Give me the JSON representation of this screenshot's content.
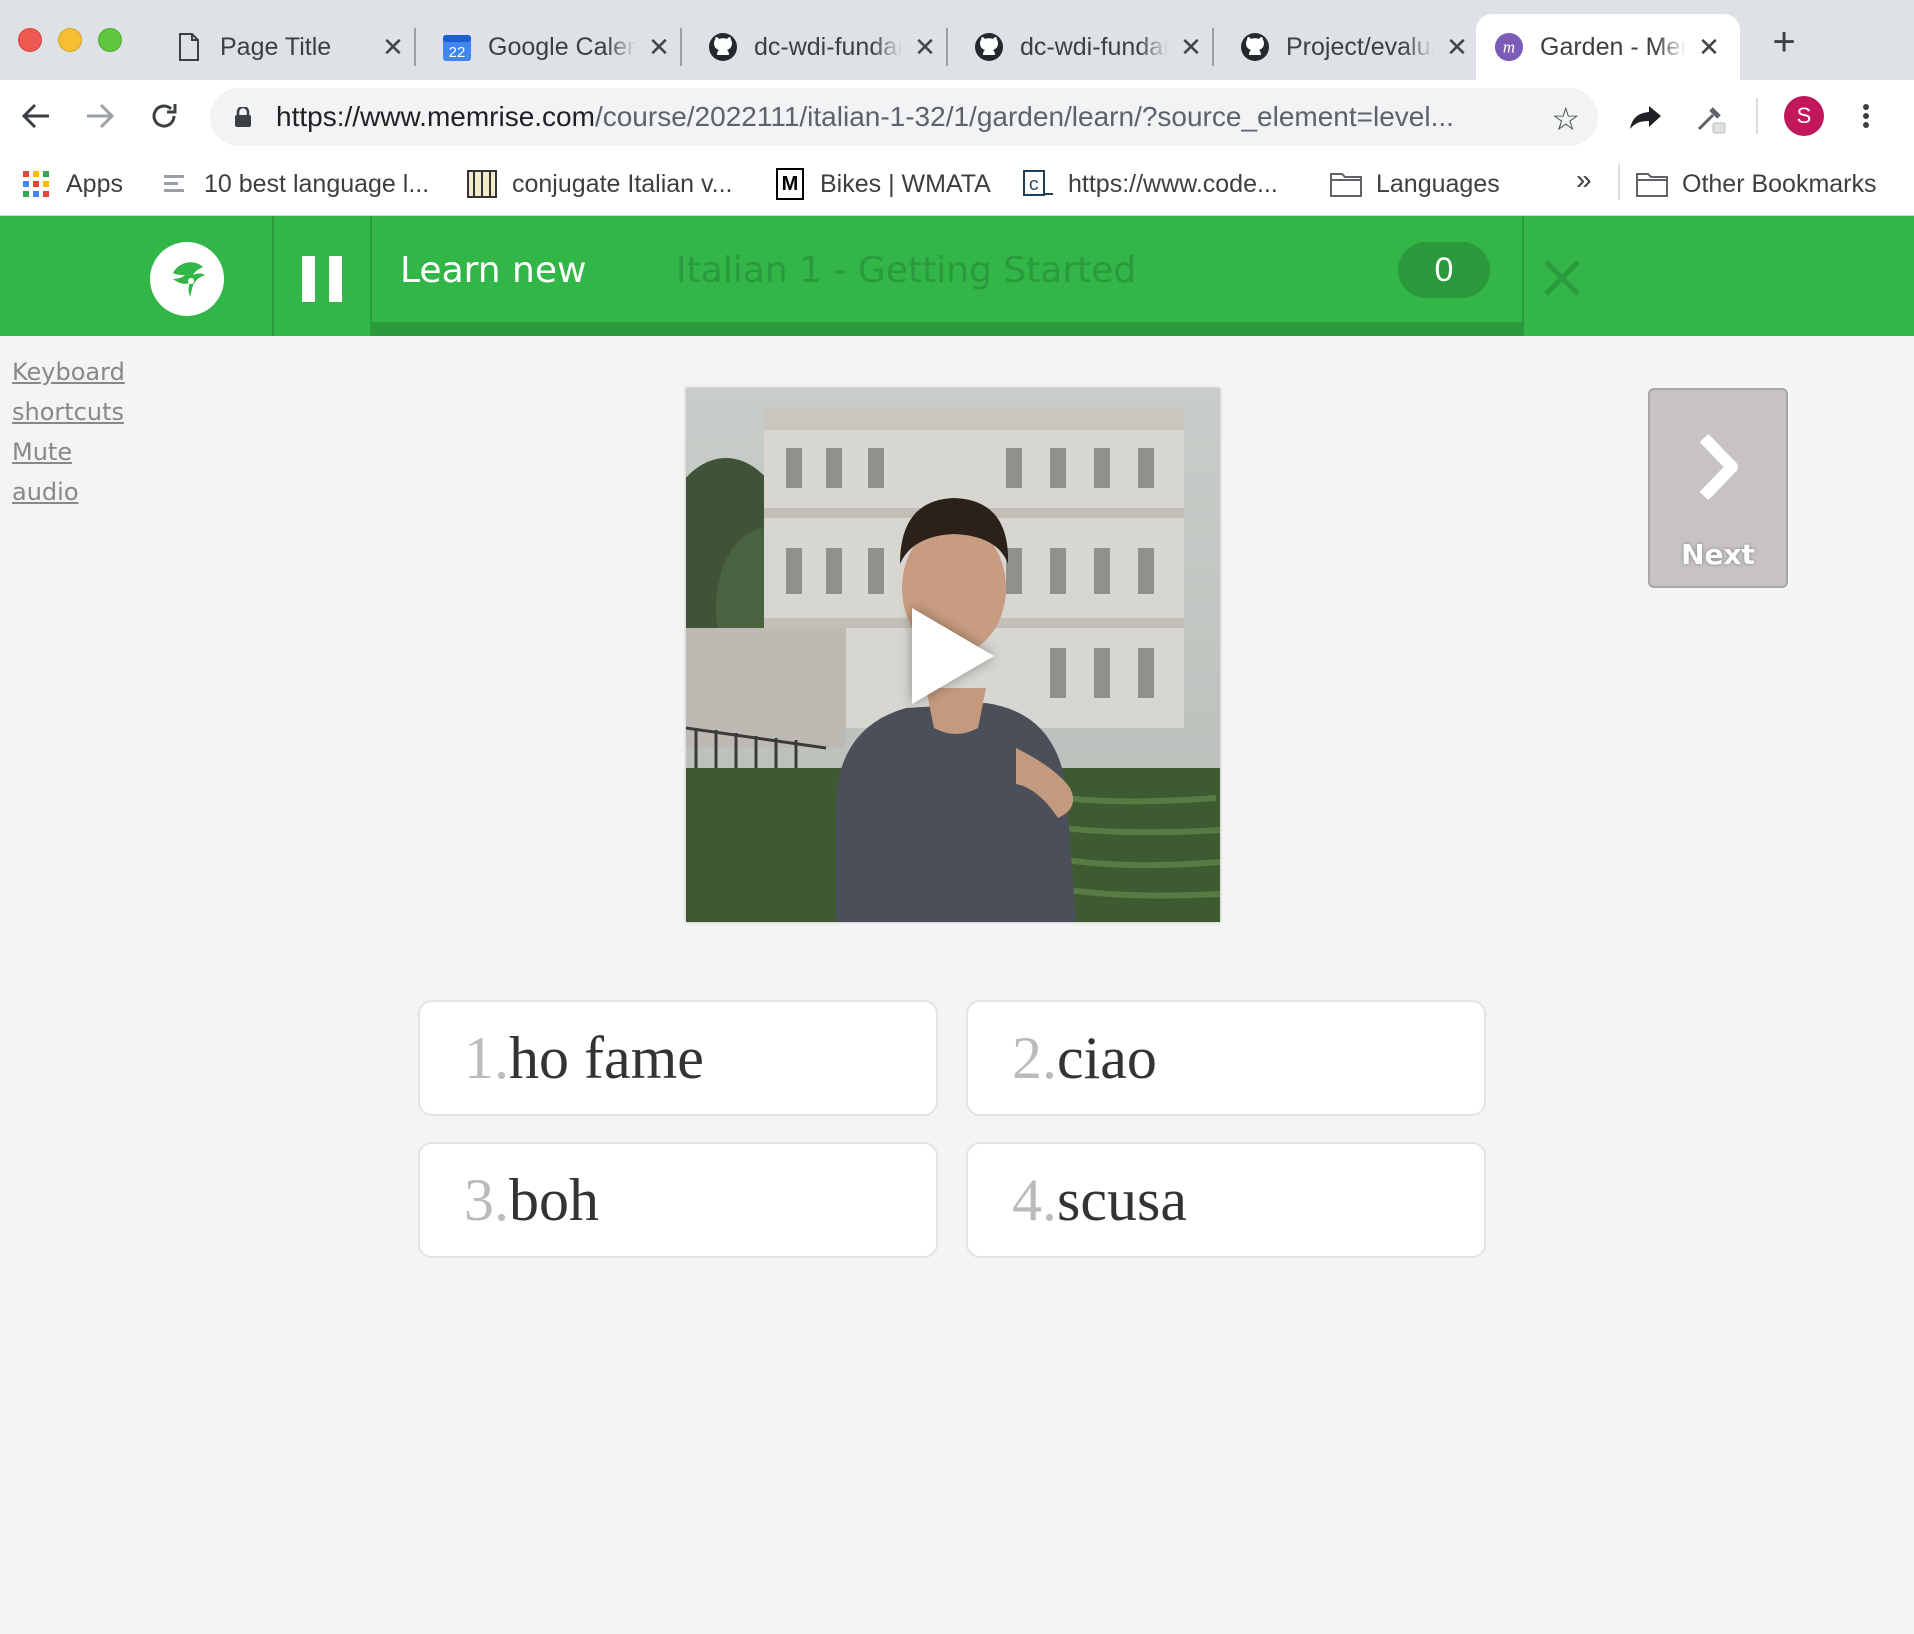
{
  "browser": {
    "tabs": [
      {
        "title": "Page Title",
        "icon": "page-icon"
      },
      {
        "title": "Google Calendar",
        "icon": "calendar-icon",
        "badge": "22"
      },
      {
        "title": "dc-wdi-fundamentals",
        "icon": "github-icon"
      },
      {
        "title": "dc-wdi-fundamentals",
        "icon": "github-icon"
      },
      {
        "title": "Project/evaluation",
        "icon": "github-icon"
      },
      {
        "title": "Garden - Memrise",
        "icon": "memrise-icon",
        "badge": "m",
        "active": true
      }
    ],
    "url_host": "https://www.memrise.com",
    "url_path": "/course/2022111/italian-1-32/1/garden/learn/?source_element=level...",
    "profile_initial": "S",
    "bookmarks": [
      {
        "label": "Apps",
        "icon": "apps-grid-icon"
      },
      {
        "label": "10 best language l...",
        "icon": "list-icon"
      },
      {
        "label": "conjugate Italian v...",
        "icon": "book-icon"
      },
      {
        "label": "Bikes | WMATA",
        "icon": "metro-icon",
        "badge": "M"
      },
      {
        "label": "https://www.code...",
        "icon": "codecademy-icon",
        "badge": "c"
      },
      {
        "label": "Languages",
        "icon": "folder-icon"
      }
    ],
    "overflow_label": "»",
    "other_bookmarks": "Other Bookmarks"
  },
  "header": {
    "mode": "Learn new",
    "course": "Italian 1 - Getting Started",
    "score": "0",
    "progress": 0
  },
  "sidebar": {
    "links": [
      "Keyboard",
      "shortcuts",
      "Mute",
      "audio"
    ]
  },
  "next_button": {
    "label": "Next"
  },
  "choices": [
    {
      "num": "1.",
      "text": "ho fame"
    },
    {
      "num": "2.",
      "text": "ciao"
    },
    {
      "num": "3.",
      "text": "boh"
    },
    {
      "num": "4.",
      "text": "scusa"
    }
  ],
  "colors": {
    "brand_green": "#33b648",
    "brand_green_dark": "#2a9a3c",
    "background": "#f4f4f4"
  }
}
